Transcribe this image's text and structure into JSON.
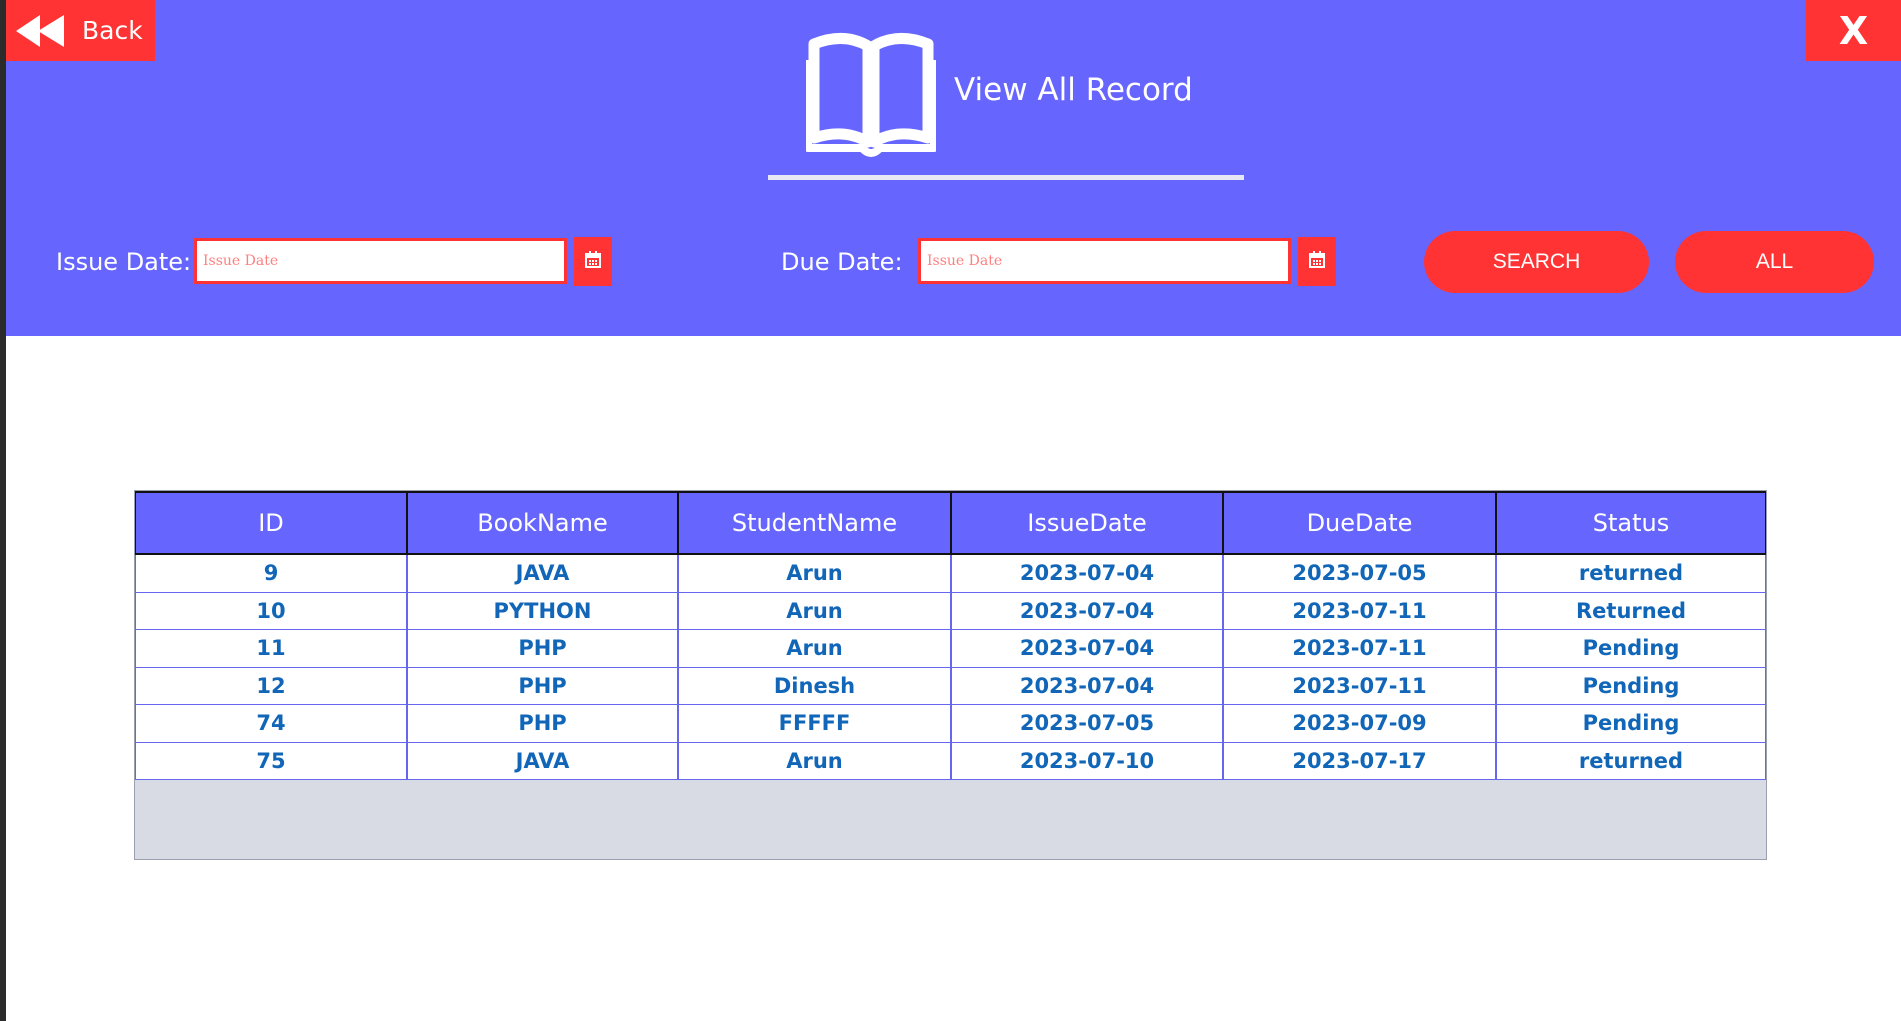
{
  "header": {
    "back_label": "Back",
    "close_label": "X",
    "title": "View All Record"
  },
  "filters": {
    "issue_label": "Issue Date:",
    "issue_placeholder": "Issue Date",
    "due_label": "Due Date:",
    "due_placeholder": "Issue Date",
    "search_label": "SEARCH",
    "all_label": "ALL"
  },
  "colors": {
    "primary": "#6666ff",
    "accent": "#ff3333",
    "cell_text": "#1166b8"
  },
  "icons": {
    "back": "rewind-icon",
    "logo": "open-book-icon",
    "calendar": "calendar-icon"
  },
  "table": {
    "columns": [
      "ID",
      "BookName",
      "StudentName",
      "IssueDate",
      "DueDate",
      "Status"
    ],
    "rows": [
      [
        "9",
        "JAVA",
        "Arun",
        "2023-07-04",
        "2023-07-05",
        "returned"
      ],
      [
        "10",
        "PYTHON",
        "Arun",
        "2023-07-04",
        "2023-07-11",
        "Returned"
      ],
      [
        "11",
        "PHP",
        "Arun",
        "2023-07-04",
        "2023-07-11",
        "Pending"
      ],
      [
        "12",
        "PHP",
        "Dinesh",
        "2023-07-04",
        "2023-07-11",
        "Pending"
      ],
      [
        "74",
        "PHP",
        "FFFFF",
        "2023-07-05",
        "2023-07-09",
        "Pending"
      ],
      [
        "75",
        "JAVA",
        "Arun",
        "2023-07-10",
        "2023-07-17",
        "returned"
      ]
    ]
  }
}
